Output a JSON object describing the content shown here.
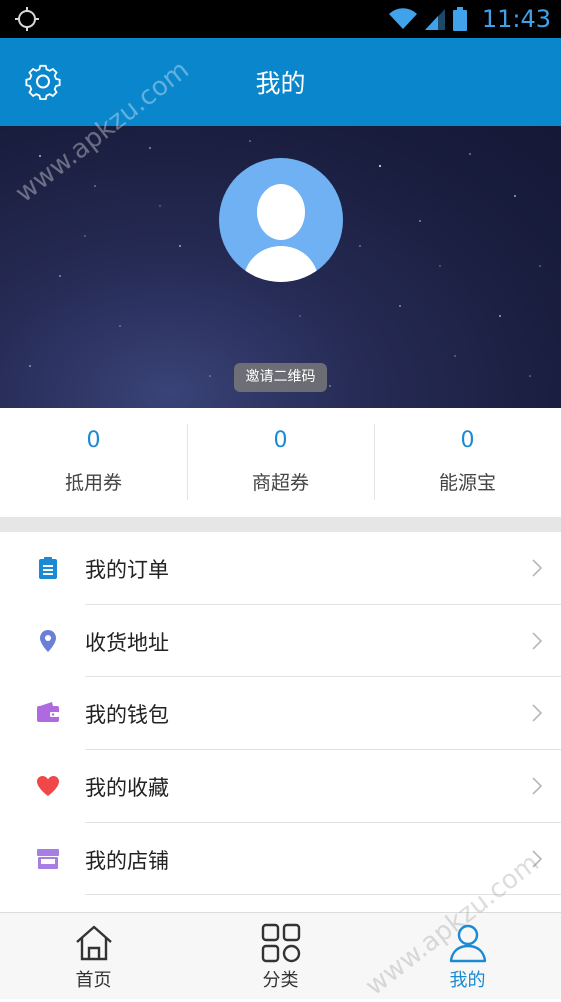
{
  "status_bar": {
    "time": "11:43",
    "icons": [
      "location-icon",
      "wifi-icon",
      "signal-icon",
      "battery-icon"
    ]
  },
  "header": {
    "title": "我的",
    "settings_icon": "gear-icon"
  },
  "profile": {
    "invite_label": "邀请二维码"
  },
  "stats": [
    {
      "value": "0",
      "label": "抵用券"
    },
    {
      "value": "0",
      "label": "商超券"
    },
    {
      "value": "0",
      "label": "能源宝"
    }
  ],
  "menu": [
    {
      "label": "我的订单",
      "icon": "clipboard-icon",
      "color": "#1a8ad4"
    },
    {
      "label": "收货地址",
      "icon": "location-pin-icon",
      "color": "#6b7fd8"
    },
    {
      "label": "我的钱包",
      "icon": "wallet-icon",
      "color": "#b06adf"
    },
    {
      "label": "我的收藏",
      "icon": "heart-icon",
      "color": "#f04848"
    },
    {
      "label": "我的店铺",
      "icon": "store-icon",
      "color": "#a77de6"
    }
  ],
  "tabs": [
    {
      "label": "首页",
      "icon": "home-icon"
    },
    {
      "label": "分类",
      "icon": "grid-icon"
    },
    {
      "label": "我的",
      "icon": "user-icon",
      "active": true
    }
  ],
  "watermark": "www.apkzu.com",
  "colors": {
    "primary": "#0a86cc",
    "accent": "#1a8ad4"
  }
}
